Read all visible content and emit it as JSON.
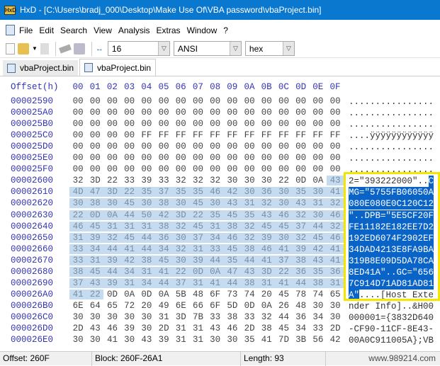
{
  "window": {
    "title": "HxD - [C:\\Users\\bradj_000\\Desktop\\Make Use Of\\VBA password\\vbaProject.bin]"
  },
  "menu": [
    "File",
    "Edit",
    "Search",
    "View",
    "Analysis",
    "Extras",
    "Window",
    "?"
  ],
  "toolbar": {
    "bytes_per_row": "16",
    "charset": "ANSI",
    "offset_base": "hex",
    "icons": [
      "new-file-icon",
      "open-file-icon",
      "save-icon",
      "ram-icon",
      "disk-icon",
      "bytes-per-row-icon"
    ]
  },
  "tabs": [
    {
      "label": "vbaProject.bin",
      "active": false
    },
    {
      "label": "vbaProject.bin",
      "active": true
    }
  ],
  "editor": {
    "offset_header": "Offset(h)",
    "columns": [
      "00",
      "01",
      "02",
      "03",
      "04",
      "05",
      "06",
      "07",
      "08",
      "09",
      "0A",
      "0B",
      "0C",
      "0D",
      "0E",
      "0F"
    ],
    "selection": {
      "start": "260F",
      "end": "26A1"
    },
    "rows": [
      {
        "offset": "00002590",
        "hex": "00 00 00 00 00 00 00 00 00 00 00 00 00 00 00 00",
        "text": "................"
      },
      {
        "offset": "000025A0",
        "hex": "00 00 00 00 00 00 00 00 00 00 00 00 00 00 00 00",
        "text": "................"
      },
      {
        "offset": "000025B0",
        "hex": "00 00 00 00 00 00 00 00 00 00 00 00 00 00 00 00",
        "text": "................"
      },
      {
        "offset": "000025C0",
        "hex": "00 00 00 00 FF FF FF FF FF FF FF FF FF FF FF FF",
        "text": "....ÿÿÿÿÿÿÿÿÿÿÿÿ"
      },
      {
        "offset": "000025D0",
        "hex": "00 00 00 00 00 00 00 00 00 00 00 00 00 00 00 00",
        "text": "................"
      },
      {
        "offset": "000025E0",
        "hex": "00 00 00 00 00 00 00 00 00 00 00 00 00 00 00 00",
        "text": "................"
      },
      {
        "offset": "000025F0",
        "hex": "00 00 00 00 00 00 00 00 00 00 00 00 00 00 00 00",
        "text": "................"
      },
      {
        "offset": "00002600",
        "hex": "32 3D 22 33 39 33 32 32 32 30 30 30 22 0D 0A 43",
        "text": "2=\"393222000\"..C"
      },
      {
        "offset": "00002610",
        "hex": "4D 47 3D 22 35 37 35 35 46 42 30 36 30 35 30 41",
        "text": "MG=\"5755FB06050A"
      },
      {
        "offset": "00002620",
        "hex": "30 38 30 45 30 38 30 45 30 43 31 32 30 43 31 32",
        "text": "080E080E0C120C12"
      },
      {
        "offset": "00002630",
        "hex": "22 0D 0A 44 50 42 3D 22 35 45 35 43 46 32 30 46",
        "text": "\"..DPB=\"5E5CF20F"
      },
      {
        "offset": "00002640",
        "hex": "46 45 31 31 31 38 32 45 31 38 32 45 45 37 44 32",
        "text": "FE11182E182EE7D2"
      },
      {
        "offset": "00002650",
        "hex": "31 39 32 45 44 36 30 37 34 46 32 39 30 32 45 46",
        "text": "192ED6074F2902EF"
      },
      {
        "offset": "00002660",
        "hex": "33 34 44 41 44 34 32 31 33 45 38 46 41 39 42 41",
        "text": "34DAD4213E8FA9BA"
      },
      {
        "offset": "00002670",
        "hex": "33 31 39 42 38 45 30 39 44 35 44 41 37 38 43 41",
        "text": "319B8E09D5DA78CA"
      },
      {
        "offset": "00002680",
        "hex": "38 45 44 34 31 41 22 0D 0A 47 43 3D 22 36 35 36",
        "text": "8ED41A\"..GC=\"656"
      },
      {
        "offset": "00002690",
        "hex": "37 43 39 31 34 44 37 31 41 44 38 31 41 44 38 31",
        "text": "7C914D71AD81AD81"
      },
      {
        "offset": "000026A0",
        "hex": "41 22 0D 0A 0D 0A 5B 48 6F 73 74 20 45 78 74 65",
        "text": "A\"....[Host Exte"
      },
      {
        "offset": "000026B0",
        "hex": "6E 64 65 72 20 49 6E 66 6F 5D 0D 0A 26 48 30 30",
        "text": "nder Info]..&H00"
      },
      {
        "offset": "000026C0",
        "hex": "30 30 30 30 30 31 3D 7B 33 38 33 32 44 36 34 30",
        "text": "000001={3832D640"
      },
      {
        "offset": "000026D0",
        "hex": "2D 43 46 39 30 2D 31 31 43 46 2D 38 45 34 33 2D",
        "text": "-CF90-11CF-8E43-"
      },
      {
        "offset": "000026E0",
        "hex": "30 30 41 30 43 39 31 31 30 30 35 41 7D 3B 56 42",
        "text": "00A0C911005A};VB"
      }
    ]
  },
  "status": {
    "offset": "Offset: 260F",
    "block": "Block: 260F-26A1",
    "length": "Length: 93"
  },
  "watermark": "www.989214.com",
  "colors": {
    "titlebar": "#0b78d0",
    "offset_text": "#3434b4",
    "selection_hex": "#c5dcf0",
    "selection_text": "#0a64c8",
    "highlight_box": "#f5e600"
  }
}
